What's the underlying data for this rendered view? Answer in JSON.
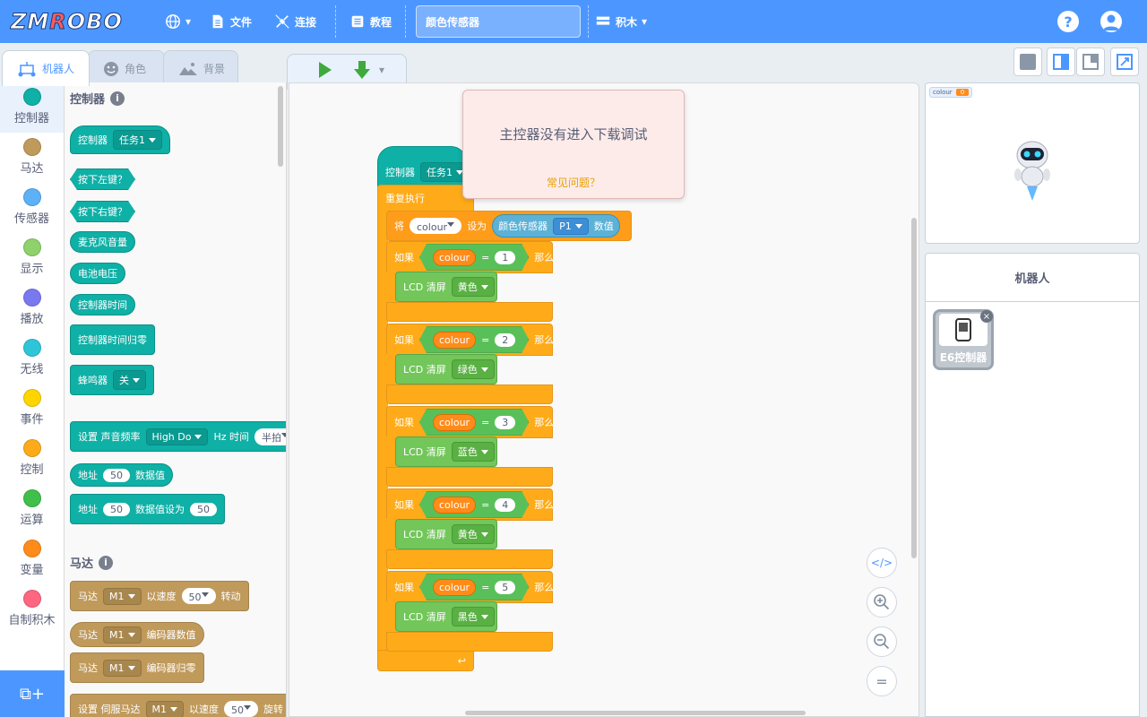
{
  "header": {
    "logo": "ZMROBO",
    "menu_file": "文件",
    "menu_connect": "连接",
    "menu_tutorial": "教程",
    "project_name": "颜色传感器",
    "menu_blocks": "积木",
    "help": "?"
  },
  "tabs": {
    "robot": "机器人",
    "character": "角色",
    "background": "背景"
  },
  "categories": [
    {
      "label": "控制器",
      "color": "#0fb0a6"
    },
    {
      "label": "马达",
      "color": "#c09a5b"
    },
    {
      "label": "传感器",
      "color": "#5cb1f7"
    },
    {
      "label": "显示",
      "color": "#8fd16b"
    },
    {
      "label": "播放",
      "color": "#7a78f0"
    },
    {
      "label": "无线",
      "color": "#2fc5d9"
    },
    {
      "label": "事件",
      "color": "#ffd500"
    },
    {
      "label": "控制",
      "color": "#ffab19"
    },
    {
      "label": "运算",
      "color": "#40bf4a"
    },
    {
      "label": "变量",
      "color": "#ff8c1a"
    },
    {
      "label": "自制积木",
      "color": "#ff6680"
    }
  ],
  "palette": {
    "controller_title": "控制器",
    "motor_title": "马达",
    "b_controller": "控制器",
    "task1": "任务1",
    "b_left_key": "按下左键？",
    "b_right_key": "按下右键？",
    "b_mic": "麦克风音量",
    "b_battery": "电池电压",
    "b_time": "控制器时间",
    "b_time_reset": "控制器时间归零",
    "b_buzzer": "蜂鸣器",
    "buzzer_off": "关",
    "b_set_freq": "设置 声音频率",
    "note": "High Do",
    "hz_time": "Hz 时间",
    "half_beat": "半拍",
    "b_addr": "地址",
    "addr_val": "50",
    "b_data_val": "数据值",
    "b_data_set": "数据值设为",
    "data_val": "50",
    "b_motor": "马达",
    "m1": "M1",
    "at_speed": "以速度",
    "speed": "50",
    "rotate": "转动",
    "encoder_val": "编码器数值",
    "encoder_reset": "编码器归零",
    "b_servo": "设置 伺服马达",
    "servo_rotate": "旋转"
  },
  "script": {
    "hat": "控制器",
    "task": "任务1",
    "repeat": "重复执行",
    "set_label": "将",
    "var": "colour",
    "set_to": "设为",
    "sensor": "颜色传感器",
    "port": "P1",
    "value": "数值",
    "if": "如果",
    "then": "那么",
    "eq": "=",
    "lcd": "LCD 清屏",
    "ifs": [
      {
        "n": "1",
        "color": "黄色"
      },
      {
        "n": "2",
        "color": "绿色"
      },
      {
        "n": "3",
        "color": "蓝色"
      },
      {
        "n": "4",
        "color": "黄色"
      },
      {
        "n": "5",
        "color": "黑色"
      }
    ]
  },
  "popup": {
    "message": "主控器没有进入下载调试",
    "link": "常见问题？"
  },
  "stage": {
    "monitor_name": "colour",
    "monitor_value": "0"
  },
  "sprites": {
    "title": "机器人",
    "item": "E6控制器"
  }
}
